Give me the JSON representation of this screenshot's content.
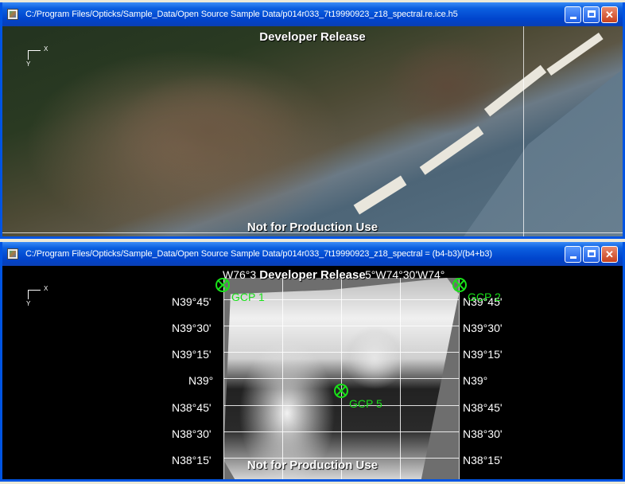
{
  "window1": {
    "title": "C:/Program Files/Opticks/Sample_Data/Open Source Sample Data/p014r033_7t19990923_z18_spectral.re.ice.h5",
    "overlay_top": "Developer Release",
    "overlay_bottom": "Not for Production Use",
    "axis_x": "X",
    "axis_y": "Y"
  },
  "window2": {
    "title": "C:/Program Files/Opticks/Sample_Data/Open Source Sample Data/p014r033_7t19990923_z18_spectral = (b4-b3)/(b4+b3)",
    "overlay_top": "Developer Release",
    "overlay_bottom": "Not for Production Use",
    "axis_x": "X",
    "axis_y": "Y",
    "top_lon_labels": "W76°3",
    "top_lon_labels_right": "5°W74°30'W74°",
    "lat_labels": [
      "N39°45'",
      "N39°30'",
      "N39°15'",
      "N39°",
      "N38°45'",
      "N38°30'",
      "N38°15'"
    ],
    "gcps": [
      {
        "name": "GCP 1"
      },
      {
        "name": "GCP 2"
      },
      {
        "name": "GCP 5"
      }
    ],
    "gcp_color": "#19e019"
  },
  "controls": {
    "minimize_icon": "minimize-icon",
    "maximize_icon": "maximize-icon",
    "close_icon": "close-icon",
    "close_glyph": "✕"
  }
}
